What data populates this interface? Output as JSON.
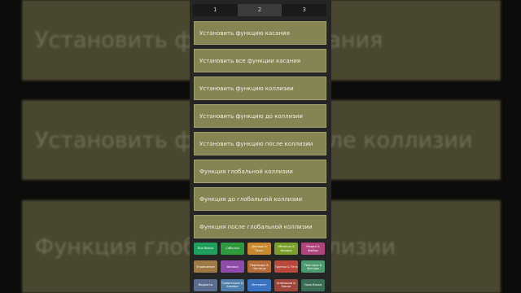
{
  "background": {
    "lines": [
      "Установить функцию касания",
      "Установить функцию после коллизии",
      "Функция глобальной коллизии"
    ]
  },
  "tabs": [
    "1",
    "2",
    "3"
  ],
  "active_tab": "2",
  "blocks": [
    "Установить функцию касания",
    "Установить все функции касания",
    "Установить функцию коллизии",
    "Установить функцию до коллизии",
    "Установить функцию после коллизии",
    "Функция глобальной коллизии",
    "Функция до глобальной коллизии",
    "Функция после глобальной коллизии"
  ],
  "block_color": "#878453",
  "categories": [
    {
      "label": "Все блоки",
      "color": "#1f9f5c"
    },
    {
      "label": "События",
      "color": "#2e9a3e"
    },
    {
      "label": "Данные & Текст",
      "color": "#c78a2e"
    },
    {
      "label": "Объекты & Физика",
      "color": "#7a9f2a"
    },
    {
      "label": "Медиа & Файлы",
      "color": "#b0457d"
    },
    {
      "label": "Управление",
      "color": "#9d7a45"
    },
    {
      "label": "Физика",
      "color": "#8e4baa"
    },
    {
      "label": "Переходы & Частицы",
      "color": "#b56b3a"
    },
    {
      "label": "Группы & Теги",
      "color": "#b8483c"
    },
    {
      "label": "Текстуры & Фигуры",
      "color": "#4c9a6d"
    },
    {
      "label": "Виджеты",
      "color": "#5b6e8f"
    },
    {
      "label": "Гравитация & Камера",
      "color": "#4f7fa8"
    },
    {
      "label": "Интернет",
      "color": "#3a73c0"
    },
    {
      "label": "Анимации & Маски",
      "color": "#a0463a"
    },
    {
      "label": "Свои блоки",
      "color": "#3b6e55"
    }
  ]
}
